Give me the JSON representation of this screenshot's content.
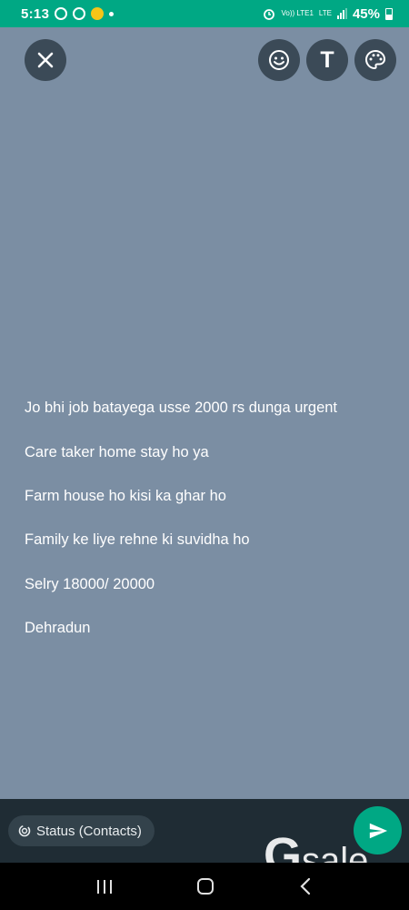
{
  "status_bar": {
    "time": "5:13",
    "network_label": "LTE",
    "volte_label": "Vo)) LTE1",
    "battery_percent": "45%"
  },
  "toolbar": {
    "close_icon": "close-icon",
    "emoji_icon": "emoji-icon",
    "text_label": "T",
    "palette_icon": "palette-icon"
  },
  "status": {
    "lines": [
      "Jo bhi job batayega usse 2000 rs dunga urgent",
      "Care taker home stay ho ya",
      "Farm house ho kisi ka ghar ho",
      "Family ke liye rehne ki suvidha ho",
      "Selry 18000/ 20000",
      "Dehradun"
    ],
    "background_color": "#7b8ea3"
  },
  "bottom": {
    "audience_label": "Status (Contacts)",
    "send_icon": "send-icon"
  },
  "watermark": {
    "brand_g": "G",
    "brand_text": "sale"
  },
  "colors": {
    "accent": "#00a884",
    "bottom_bar": "#1f2c34"
  }
}
